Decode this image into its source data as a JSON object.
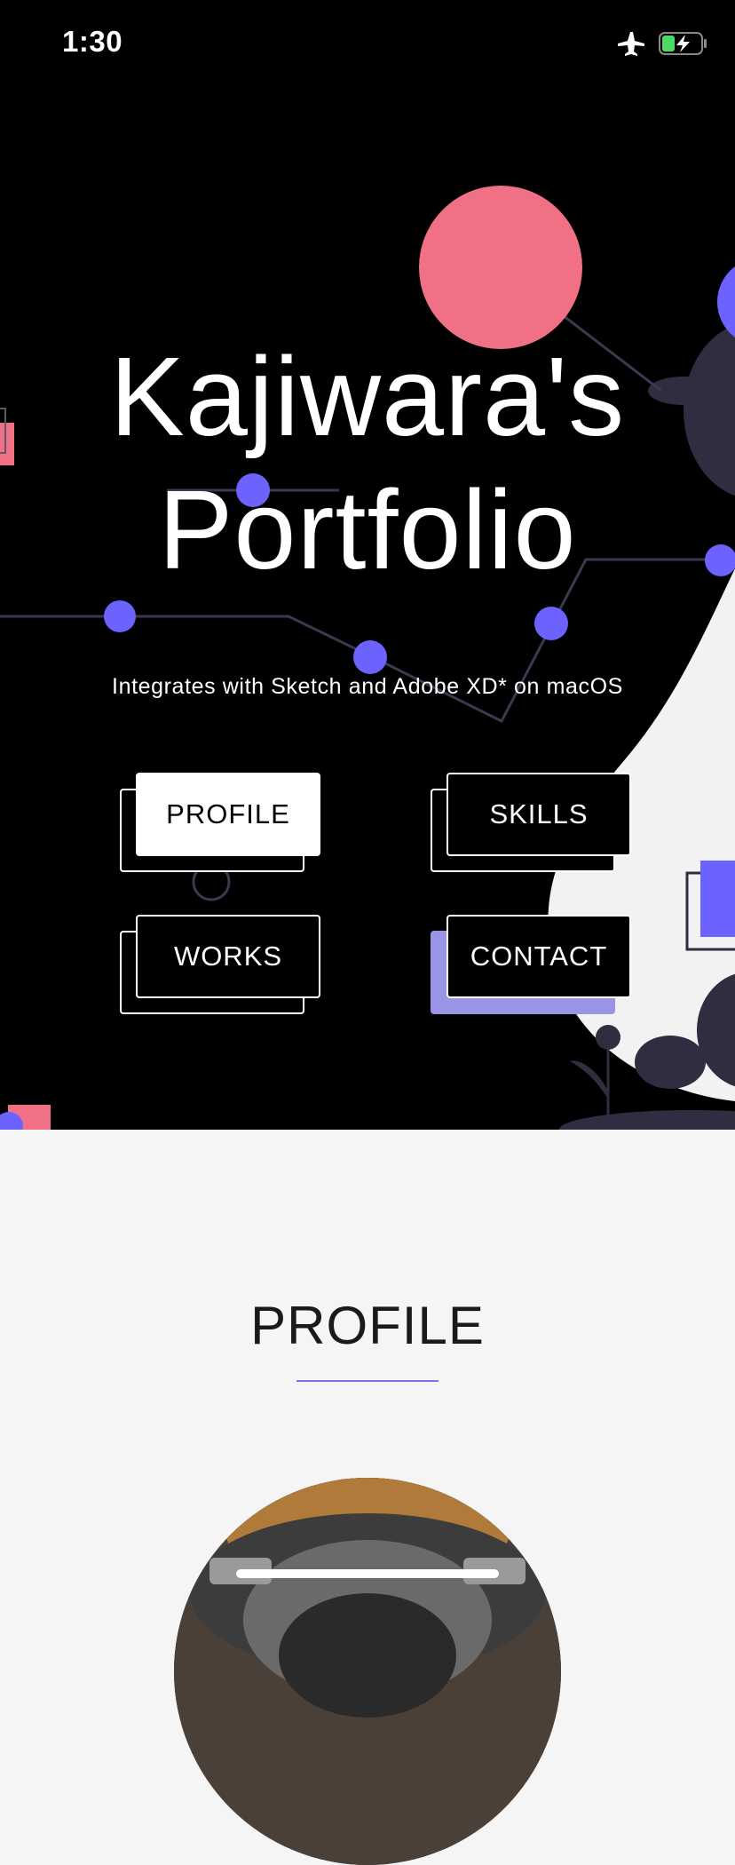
{
  "status_bar": {
    "time": "1:30",
    "airplane_icon": "airplane-icon",
    "battery_icon": "battery-charging-icon"
  },
  "hero": {
    "title_line1": "Kajiwara's",
    "title_line2": "Portfolio",
    "subtitle": "Integrates with Sketch and Adobe XD* on macOS"
  },
  "nav": {
    "profile": "PROFILE",
    "skills": "SKILLS",
    "works": "WORKS",
    "contact": "CONTACT"
  },
  "profile_section": {
    "heading": "PROFILE"
  },
  "colors": {
    "accent_purple": "#6c63ff",
    "accent_pink": "#f07186",
    "hero_background": "#000000",
    "page_background": "#f5f5f5"
  }
}
